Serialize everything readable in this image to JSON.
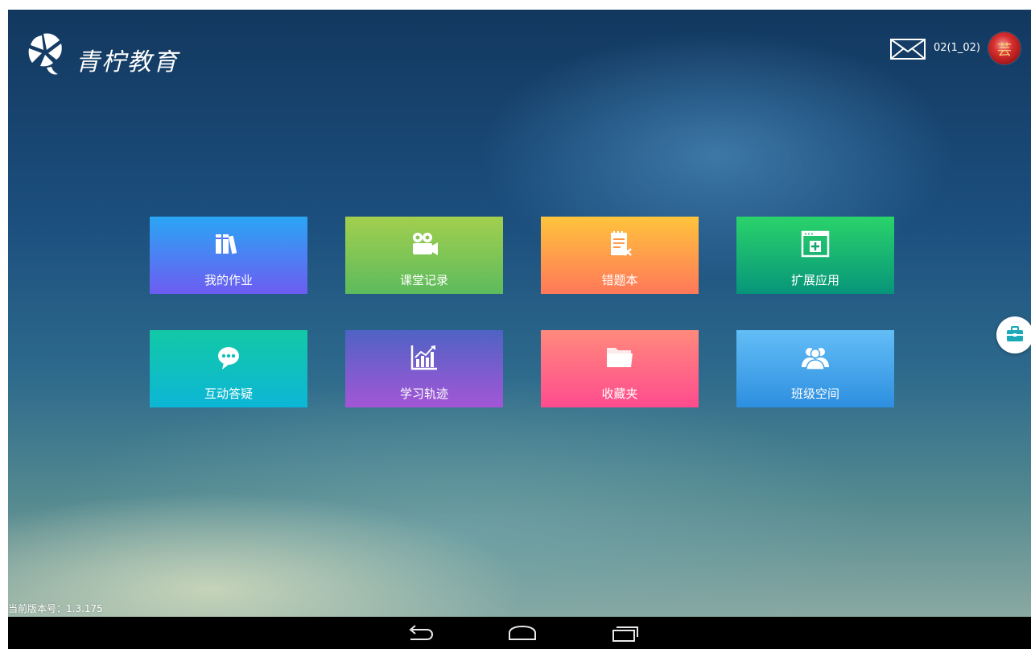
{
  "header": {
    "brand": "青柠教育",
    "username": "02(1_02)",
    "avatar_char": "芸",
    "icons": {
      "logo": "lemon-logo-icon",
      "mail": "mail-icon",
      "avatar": "avatar"
    }
  },
  "tiles": [
    {
      "label": "我的作业",
      "icon": "books-icon"
    },
    {
      "label": "课堂记录",
      "icon": "video-camera-icon"
    },
    {
      "label": "错题本",
      "icon": "notebook-x-icon"
    },
    {
      "label": "扩展应用",
      "icon": "add-window-icon"
    },
    {
      "label": "互动答疑",
      "icon": "chat-bubble-icon"
    },
    {
      "label": "学习轨迹",
      "icon": "growth-chart-icon"
    },
    {
      "label": "收藏夹",
      "icon": "folder-icon"
    },
    {
      "label": "班级空间",
      "icon": "group-icon"
    }
  ],
  "side_button": {
    "icon": "toolbox-icon"
  },
  "footer": {
    "version": "当前版本号：1.3.175"
  },
  "navbar": {
    "icons": [
      "back-icon",
      "home-icon",
      "recent-apps-icon"
    ]
  },
  "colors": {
    "background_top": "#12385f",
    "background_bottom": "#8aa9a2",
    "tile_gradients": [
      [
        "#2aa6f4",
        "#6d5cf2"
      ],
      [
        "#a2cf4e",
        "#5dbb5d"
      ],
      [
        "#ffc43c",
        "#ff785a"
      ],
      [
        "#2ad36a",
        "#07957a"
      ],
      [
        "#12c9a6",
        "#0cb6d6"
      ],
      [
        "#4f63c4",
        "#a356d6"
      ],
      [
        "#ff8a7c",
        "#ff4b8e"
      ],
      [
        "#63bdf6",
        "#2d8fe0"
      ]
    ],
    "navbar": "#000000"
  }
}
